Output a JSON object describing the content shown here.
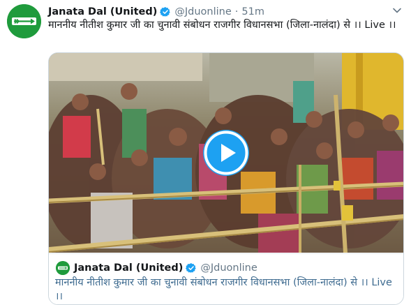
{
  "tweet": {
    "author_name": "Janata Dal (United)",
    "handle": "@Jduonline",
    "separator": "·",
    "time": "51m",
    "text": "माननीय नीतीश कुमार जी का चुनावी संबोधन  राजगीर विधानसभा (जिला-नालंदा) से ।। Live ।।"
  },
  "quoted": {
    "author_name": "Janata Dal (United)",
    "handle": "@Jduonline",
    "text": "माननीय नीतीश कुमार जी का चुनावी संबोधन राजगीर विधानसभा (जिला-नालंदा) से ।। Live ।।"
  },
  "icons": {
    "verified": "verified-badge-icon",
    "more": "chevron-down-icon",
    "play": "play-icon",
    "logo": "arrow-logo-icon"
  },
  "colors": {
    "brand_green": "#1f9b3c",
    "verified_blue": "#1da1f2",
    "play_blue": "#1da1f2",
    "secondary_text": "#657786",
    "quote_text": "#3d6a8f"
  }
}
